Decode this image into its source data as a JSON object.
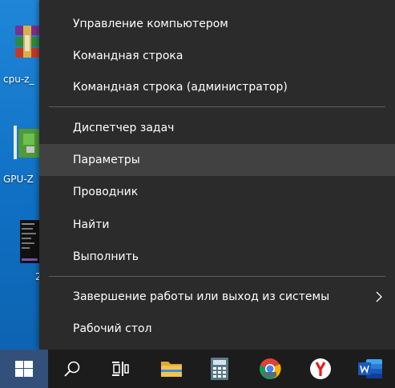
{
  "desktop": {
    "icons": [
      {
        "name": "cpu-z-icon",
        "label": "cpu-z_"
      },
      {
        "name": "gpu-z-icon",
        "label": "GPU-Z"
      },
      {
        "name": "file-icon",
        "label": "2"
      }
    ]
  },
  "menu": {
    "group1": [
      "Управление компьютером",
      "Командная строка",
      "Командная строка (администратор)"
    ],
    "group2": [
      "Диспетчер задач",
      "Параметры",
      "Проводник",
      "Найти",
      "Выполнить"
    ],
    "group3": [
      "Завершение работы или выход из системы",
      "Рабочий стол"
    ]
  },
  "taskbar": {
    "icons": [
      "windows-start-icon",
      "search-icon",
      "task-view-icon",
      "file-explorer-icon",
      "calculator-icon",
      "chrome-beta-icon",
      "yandex-browser-icon",
      "word-icon"
    ]
  },
  "colors": {
    "menu_bg": "#2b2b2b",
    "menu_hover": "#414141",
    "taskbar_bg": "#1c1c1c",
    "start_bg": "#33507a",
    "desktop_bg": "#1170c4"
  }
}
